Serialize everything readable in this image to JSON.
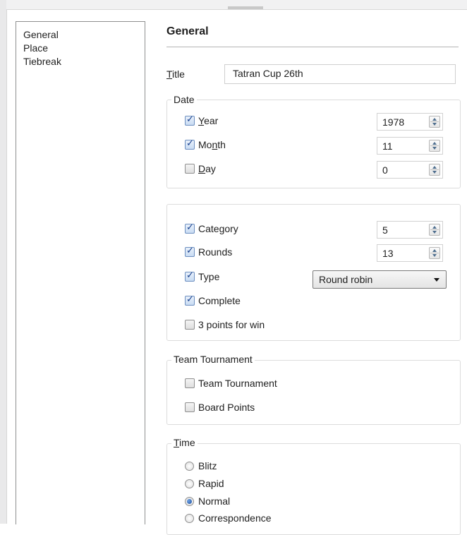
{
  "sidebar": {
    "items": [
      {
        "label": "General"
      },
      {
        "label": "Place"
      },
      {
        "label": "Tiebreak"
      }
    ]
  },
  "main": {
    "heading": "General",
    "title_field": {
      "label_first": "T",
      "label_rest": "itle",
      "value": "Tatran Cup 26th"
    },
    "date": {
      "legend": "Date",
      "year": {
        "label_first": "Y",
        "label_rest": "ear",
        "checked": true,
        "value": "1978"
      },
      "month": {
        "label_before": "Mo",
        "label_underlined": "n",
        "label_after": "th",
        "checked": true,
        "value": "11"
      },
      "day": {
        "label_first": "D",
        "label_rest": "ay",
        "checked": false,
        "value": "0"
      }
    },
    "details": {
      "category": {
        "label": "Category",
        "checked": true,
        "value": "5"
      },
      "rounds": {
        "label": "Rounds",
        "checked": true,
        "value": "13"
      },
      "type": {
        "label": "Type",
        "checked": true,
        "selected": "Round robin"
      },
      "complete": {
        "label": "Complete",
        "checked": true
      },
      "three_points": {
        "label": "3 points for win",
        "checked": false
      }
    },
    "team": {
      "legend": "Team Tournament",
      "team_tournament": {
        "label": "Team Tournament",
        "checked": false
      },
      "board_points": {
        "label": "Board Points",
        "checked": false
      }
    },
    "time": {
      "legend_first": "T",
      "legend_rest": "ime",
      "options": [
        {
          "label": "Blitz",
          "selected": false
        },
        {
          "label": "Rapid",
          "selected": false
        },
        {
          "label": "Normal",
          "selected": true
        },
        {
          "label": "Correspondence",
          "selected": false
        }
      ]
    }
  }
}
